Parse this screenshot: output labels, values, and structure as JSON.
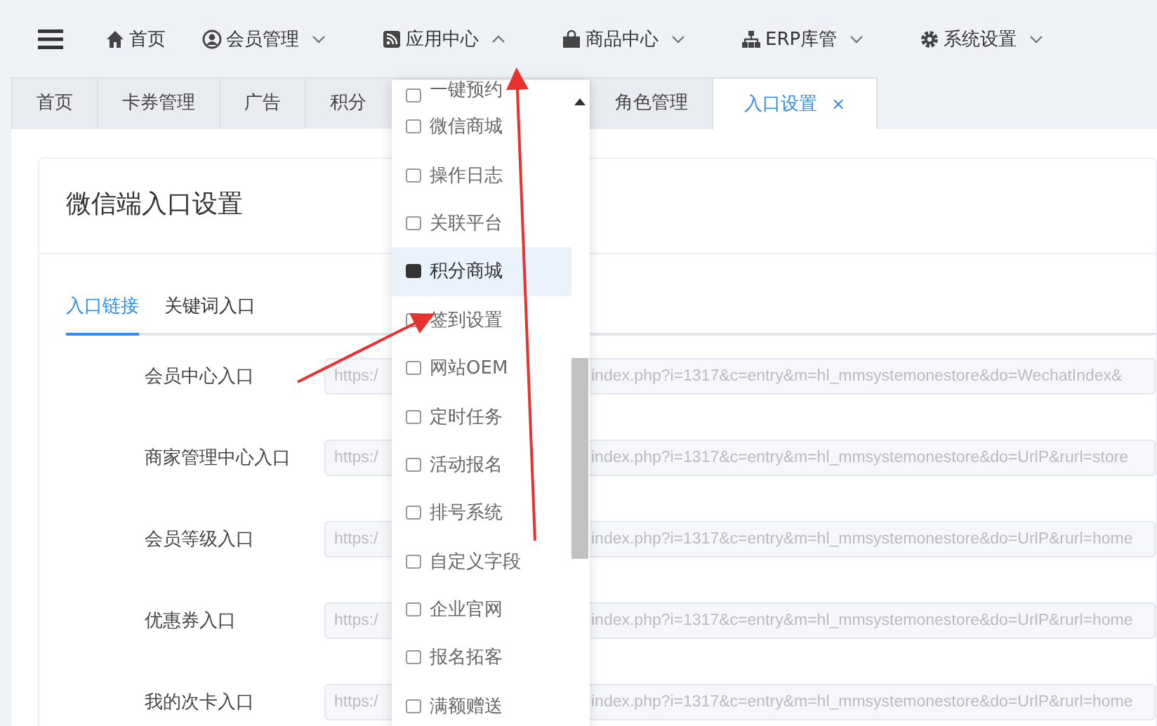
{
  "nav": {
    "items": [
      {
        "label": "首页"
      },
      {
        "label": "会员管理",
        "expanded": false
      },
      {
        "label": "应用中心",
        "expanded": true
      },
      {
        "label": "商品中心",
        "expanded": false
      },
      {
        "label": "ERP库管",
        "expanded": false
      },
      {
        "label": "系统设置",
        "expanded": false
      }
    ]
  },
  "tabs": [
    {
      "label": "首页",
      "selected": false
    },
    {
      "label": "卡券管理",
      "selected": false
    },
    {
      "label": "广告",
      "selected": false
    },
    {
      "label": "积分",
      "selected": false
    },
    {
      "label": "角色管理",
      "selected": false
    },
    {
      "label": "入口设置",
      "selected": true,
      "close": "×"
    }
  ],
  "card": {
    "title": "微信端入口设置",
    "subtabs": [
      {
        "label": "入口链接",
        "selected": true
      },
      {
        "label": "关键词入口",
        "selected": false
      }
    ],
    "rows": [
      {
        "label": "会员中心入口",
        "value_start": "https:/",
        "value_end": "index.php?i=1317&c=entry&m=hl_mmsystemonestore&do=WechatIndex&"
      },
      {
        "label": "商家管理中心入口",
        "value_start": "https:/",
        "value_end": "index.php?i=1317&c=entry&m=hl_mmsystemonestore&do=UrlP&rurl=store"
      },
      {
        "label": "会员等级入口",
        "value_start": "https:/",
        "value_end": "index.php?i=1317&c=entry&m=hl_mmsystemonestore&do=UrlP&rurl=home"
      },
      {
        "label": "优惠券入口",
        "value_start": "https:/",
        "value_end": "index.php?i=1317&c=entry&m=hl_mmsystemonestore&do=UrlP&rurl=home"
      },
      {
        "label": "我的次卡入口",
        "value_start": "https:/",
        "value_end": "index.php?i=1317&c=entry&m=hl_mmsystemonestore&do=UrlP&rurl=home"
      }
    ]
  },
  "dropdown": {
    "items": [
      {
        "label": "一键预约",
        "selected": false
      },
      {
        "label": "微信商城",
        "selected": false
      },
      {
        "label": "操作日志",
        "selected": false
      },
      {
        "label": "关联平台",
        "selected": false
      },
      {
        "label": "积分商城",
        "selected": true
      },
      {
        "label": "签到设置",
        "selected": false
      },
      {
        "label": "网站OEM",
        "selected": false
      },
      {
        "label": "定时任务",
        "selected": false
      },
      {
        "label": "活动报名",
        "selected": false
      },
      {
        "label": "排号系统",
        "selected": false
      },
      {
        "label": "自定义字段",
        "selected": false
      },
      {
        "label": "企业官网",
        "selected": false
      },
      {
        "label": "报名拓客",
        "selected": false
      },
      {
        "label": "满额赠送",
        "selected": false
      }
    ]
  }
}
